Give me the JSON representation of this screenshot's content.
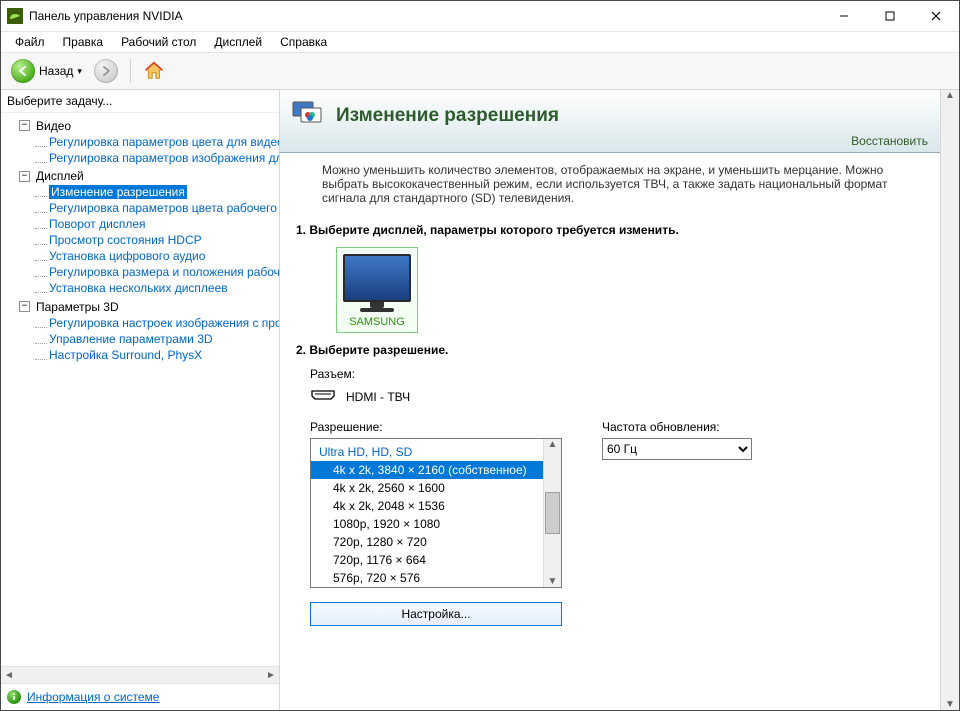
{
  "window": {
    "title": "Панель управления NVIDIA"
  },
  "menu": {
    "file": "Файл",
    "edit": "Правка",
    "desktop": "Рабочий стол",
    "display": "Дисплей",
    "help": "Справка"
  },
  "toolbar": {
    "back": "Назад"
  },
  "sidebar": {
    "prompt": "Выберите задачу...",
    "cats": {
      "video": "Видео",
      "display": "Дисплей",
      "params3d": "Параметры 3D"
    },
    "items": {
      "video_color": "Регулировка параметров цвета для видео",
      "video_image": "Регулировка параметров изображения для видео",
      "change_res": "Изменение разрешения",
      "desk_color": "Регулировка параметров цвета рабочего стола",
      "rotate": "Поворот дисплея",
      "hdcp": "Просмотр состояния HDCP",
      "digital_audio": "Установка цифрового аудио",
      "size_pos": "Регулировка размера и положения рабочего стола",
      "multi_disp": "Установка нескольких дисплеев",
      "img3d": "Регулировка настроек изображения с просмотром",
      "manage3d": "Управление параметрами 3D",
      "surround": "Настройка Surround, PhysX"
    },
    "sysinfo": "Информация о системе"
  },
  "page": {
    "title": "Изменение разрешения",
    "restore": "Восстановить",
    "description": "Можно уменьшить количество элементов, отображаемых на экране, и уменьшить мерцание. Можно выбрать высококачественный режим, если используется ТВЧ, а также задать национальный формат сигнала для стандартного (SD) телевидения.",
    "step1_title": "1. Выберите дисплей, параметры которого требуется изменить.",
    "monitor_name": "SAMSUNG",
    "step2_title": "2. Выберите разрешение.",
    "connector_label": "Разъем:",
    "connector_value": "HDMI - ТВЧ",
    "resolution_label": "Разрешение:",
    "refresh_label": "Частота обновления:",
    "refresh_value": "60 Гц",
    "resolutions": {
      "group": "Ultra HD, HD, SD",
      "r0": "4k x 2k, 3840 × 2160 (собственное)",
      "r1": "4k x 2k, 2560 × 1600",
      "r2": "4k x 2k, 2048 × 1536",
      "r3": "1080p, 1920 × 1080",
      "r4": "720p, 1280 × 720",
      "r5": "720p, 1176 × 664",
      "r6": "576p, 720 × 576"
    },
    "settings_button": "Настройка..."
  }
}
